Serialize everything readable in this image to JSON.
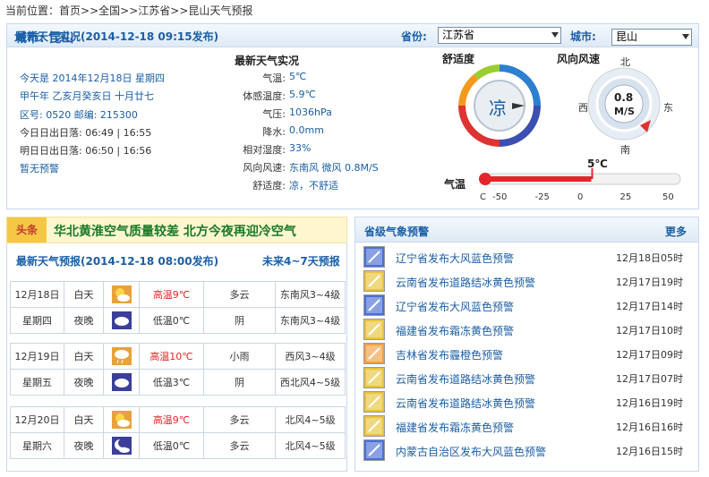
{
  "breadcrumb": {
    "prefix": "当前位置：",
    "home": "首页",
    "sep": ">>",
    "country": "全国",
    "province": "江苏省",
    "page": "昆山天气预报"
  },
  "current": {
    "title": "最新天气实况(2014-12-18 09:15发布)",
    "province_label": "省份:",
    "province_value": "江苏省",
    "city_label": "城市:",
    "city_value": "昆山",
    "city_name": "城市: 昆山",
    "today": "今天是 2014年12月18日 星期四",
    "lunar": "甲午年 乙亥月癸亥日 十月廿七",
    "codes": "区号: 0520  邮编: 215300",
    "sun_today": "今日日出日落: 06:49 | 16:55",
    "sun_tomorrow": "明日日出日落: 06:50 | 16:56",
    "no_warning": "暂无预警",
    "obs_title": "最新天气实况",
    "obs": [
      {
        "k": "气温:",
        "v": "5℃"
      },
      {
        "k": "体感温度:",
        "v": "5.9℃"
      },
      {
        "k": "气压:",
        "v": "1036hPa"
      },
      {
        "k": "降水:",
        "v": "0.0mm"
      },
      {
        "k": "相对湿度:",
        "v": "33%"
      },
      {
        "k": "风向风速:",
        "v": "东南风 微风 0.8M/S"
      },
      {
        "k": "舒适度:",
        "v": "凉，不舒适"
      }
    ],
    "comfort_title": "舒适度",
    "comfort_value": "凉",
    "wind_title": "风向风速",
    "wind_speed": "0.8",
    "wind_unit": "M/S",
    "dir_n": "北",
    "dir_s": "南",
    "dir_e": "东",
    "dir_w": "西",
    "temp_title": "气温",
    "temp_value": "5℃",
    "temp_ticks": [
      "C",
      "-50",
      "-25",
      "0",
      "25",
      "50"
    ]
  },
  "headline": {
    "tag": "头条",
    "text": "华北黄淮空气质量较差 北方今夜再迎冷空气"
  },
  "forecast": {
    "title": "最新天气预报(2014-12-18 08:00发布)",
    "more": "未来4~7天预报",
    "days": [
      {
        "date": "12月18日",
        "week": "星期四",
        "day": {
          "label": "白天",
          "temp": "高温9℃",
          "wx": "多云",
          "wind": "东南风3~4级",
          "icon": "partly-cloudy-icon"
        },
        "night": {
          "label": "夜晚",
          "temp": "低温0℃",
          "wx": "阴",
          "wind": "东南风3~4级",
          "icon": "overcast-night-icon"
        }
      },
      {
        "date": "12月19日",
        "week": "星期五",
        "day": {
          "label": "白天",
          "temp": "高温10℃",
          "wx": "小雨",
          "wind": "西风3~4级",
          "icon": "light-rain-icon"
        },
        "night": {
          "label": "夜晚",
          "temp": "低温3℃",
          "wx": "阴",
          "wind": "西北风4~5级",
          "icon": "overcast-night-icon"
        }
      },
      {
        "date": "12月20日",
        "week": "星期六",
        "day": {
          "label": "白天",
          "temp": "高温9℃",
          "wx": "多云",
          "wind": "北风4~5级",
          "icon": "partly-cloudy-icon"
        },
        "night": {
          "label": "夜晚",
          "temp": "低温0℃",
          "wx": "多云",
          "wind": "北风4~5级",
          "icon": "cloudy-night-icon"
        }
      }
    ]
  },
  "alerts": {
    "title": "省级气象预警",
    "more": "更多",
    "items": [
      {
        "text": "辽宁省发布大风蓝色预警",
        "time": "12月18日05时",
        "color": "#4a6fd6",
        "icon": "gale-warning-icon"
      },
      {
        "text": "云南省发布道路结冰黄色预警",
        "time": "12月17日19时",
        "color": "#e8c33a",
        "icon": "road-icing-warning-icon"
      },
      {
        "text": "辽宁省发布大风蓝色预警",
        "time": "12月17日14时",
        "color": "#4a6fd6",
        "icon": "gale-warning-icon"
      },
      {
        "text": "福建省发布霜冻黄色预警",
        "time": "12月17日10时",
        "color": "#e8c33a",
        "icon": "frost-warning-icon"
      },
      {
        "text": "吉林省发布霾橙色预警",
        "time": "12月17日09时",
        "color": "#f0a040",
        "icon": "haze-warning-icon"
      },
      {
        "text": "云南省发布道路结冰黄色预警",
        "time": "12月17日07时",
        "color": "#e8c33a",
        "icon": "road-icing-warning-icon"
      },
      {
        "text": "云南省发布道路结冰黄色预警",
        "time": "12月16日19时",
        "color": "#e8c33a",
        "icon": "road-icing-warning-icon"
      },
      {
        "text": "福建省发布霜冻黄色预警",
        "time": "12月16日16时",
        "color": "#e8c33a",
        "icon": "frost-warning-icon"
      },
      {
        "text": "内蒙古自治区发布大风蓝色预警",
        "time": "12月16日15时",
        "color": "#4a6fd6",
        "icon": "gale-warning-icon"
      }
    ]
  }
}
